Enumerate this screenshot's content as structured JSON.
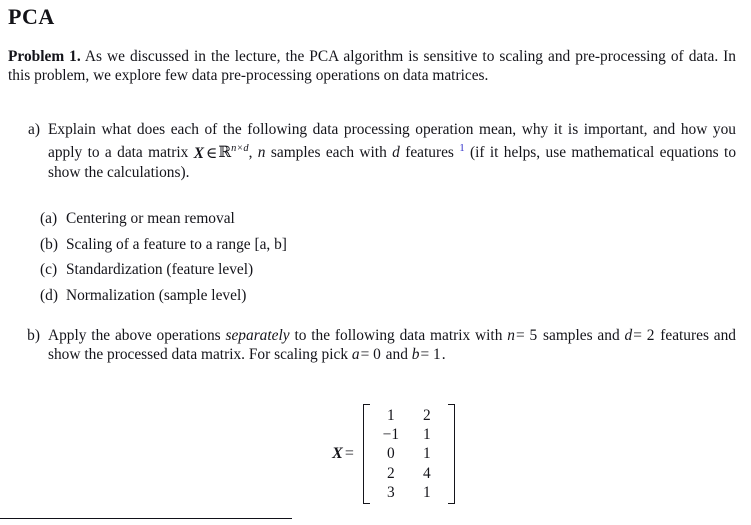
{
  "document": {
    "title": "PCA",
    "intro": {
      "lead_in": "Problem 1.",
      "text": "As we discussed in the lecture, the PCA algorithm is sensitive to scaling and pre-processing of data. In this problem, we explore few data pre-processing operations on data matrices."
    },
    "items": [
      {
        "marker": "a)",
        "text_part1": "Explain what does each of the following data processing operation mean, why it is important, and how you apply to a data matrix ",
        "matrix_symbol": "X",
        "element_of": "∈",
        "space_symbol": "ℝ",
        "space_superscript": "n×d",
        "text_part2": ", ",
        "n_symbol": "n",
        "text_part3": " samples each with ",
        "d_symbol": "d",
        "text_part4": " features ",
        "footnote_marker": "1",
        "text_part5": " (if it helps, use mathematical equations to show the calculations)."
      },
      {
        "marker": "b)",
        "text_part1": "Apply the above operations ",
        "emphasis": "separately",
        "text_part2": " to the following data matrix with ",
        "n_symbol": "n",
        "n_eq": "= 5",
        "text_part3": " samples and ",
        "d_symbol": "d",
        "d_eq": "= 2",
        "text_part4": " features and show the processed data matrix. For scaling pick ",
        "a_symbol": "a",
        "a_eq": "= 0",
        "text_part5": " and ",
        "b_symbol": "b",
        "b_eq": "= 1",
        "text_part6": "."
      }
    ],
    "sublist": [
      {
        "marker": "(a)",
        "label": "Centering or mean removal"
      },
      {
        "marker": "(b)",
        "label": "Scaling of a feature to a range [a, b]"
      },
      {
        "marker": "(c)",
        "label": "Standardization (feature level)"
      },
      {
        "marker": "(d)",
        "label": "Normalization (sample level)"
      }
    ],
    "equation": {
      "lhs_symbol": "X",
      "equals": "=",
      "matrix": [
        [
          "1",
          "2"
        ],
        [
          "−1",
          "1"
        ],
        [
          "0",
          "1"
        ],
        [
          "2",
          "4"
        ],
        [
          "3",
          "1"
        ]
      ]
    },
    "colors": {
      "text": "#14141a",
      "footnote_link": "#2b2bc8",
      "background": "#ffffff"
    }
  }
}
